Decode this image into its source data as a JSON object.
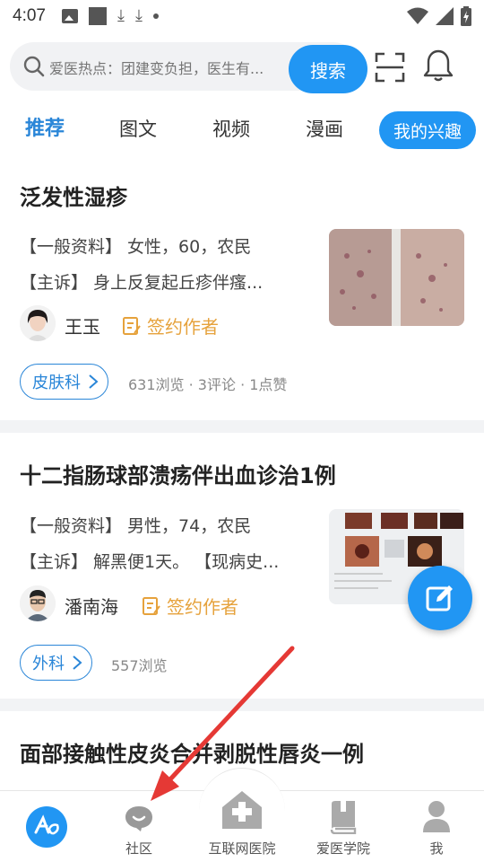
{
  "status_bar": {
    "time": "4:07"
  },
  "search": {
    "placeholder": "爱医热点：团建变负担，医生有...",
    "button_label": "搜索"
  },
  "tabs": [
    {
      "label": "推荐",
      "active": true
    },
    {
      "label": "图文"
    },
    {
      "label": "视频"
    },
    {
      "label": "漫画"
    },
    {
      "label": "我的兴趣",
      "chip": true
    }
  ],
  "feed": [
    {
      "title": "泛发性湿疹",
      "line1": "【一般资料】 女性，60，农民",
      "line2": "【主诉】 身上反复起丘疹伴瘙...",
      "author": "王玉",
      "signed_label": "签约作者",
      "dept": "皮肤科",
      "stats": "631浏览 · 3评论 · 1点赞"
    },
    {
      "title": "十二指肠球部溃疡伴出血诊治1例",
      "line1": "【一般资料】 男性，74，农民",
      "line2": "【主诉】 解黑便1天。 【现病史...",
      "author": "潘南海",
      "signed_label": "签约作者",
      "dept": "外科",
      "stats": "557浏览"
    },
    {
      "title": "面部接触性皮炎合并剥脱性唇炎一例"
    }
  ],
  "bottom_nav": [
    {
      "label": ""
    },
    {
      "label": "社区"
    },
    {
      "label": "互联网医院"
    },
    {
      "label": "爱医学院"
    },
    {
      "label": "我"
    }
  ],
  "colors": {
    "accent": "#2196f3",
    "tab_active": "#2a86d8",
    "signed": "#e6a23c",
    "annotation_arrow": "#e53935"
  }
}
